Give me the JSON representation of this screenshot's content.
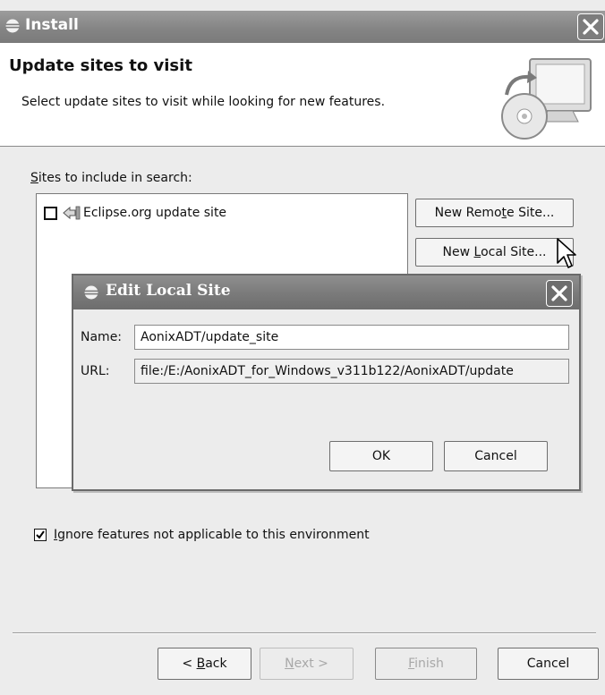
{
  "window": {
    "title": "Install"
  },
  "banner": {
    "title": "Update sites to visit",
    "description": "Select update sites to visit while looking for new features."
  },
  "sites": {
    "label_mnemonic": "S",
    "label_rest": "ites to include in search:",
    "items": [
      {
        "label": "Eclipse.org update site",
        "checked": false
      }
    ]
  },
  "buttons": {
    "new_remote_pre": "New Remo",
    "new_remote_mnemonic": "t",
    "new_remote_post": "e Site...",
    "new_local_pre": "New ",
    "new_local_mnemonic": "L",
    "new_local_post": "ocal Site..."
  },
  "dialog": {
    "title": "Edit Local Site",
    "name_label": "Name:",
    "name_value": "AonixADT/update_site",
    "url_label": "URL:",
    "url_value": "file:/E:/AonixADT_for_Windows_v311b122/AonixADT/update",
    "ok_label": "OK",
    "cancel_label": "Cancel"
  },
  "ignore_option": {
    "checked": true,
    "mnemonic": "I",
    "label_rest": "gnore features not applicable to this environment"
  },
  "footer": {
    "back_pre": "< ",
    "back_mnemonic": "B",
    "back_post": "ack",
    "next_mnemonic": "N",
    "next_post": "ext >",
    "finish_mnemonic": "F",
    "finish_post": "inish",
    "cancel_label": "Cancel"
  },
  "icons": {
    "window": "eclipse-icon",
    "close": "close-icon",
    "banner": "install-computer-cd-icon",
    "site": "update-site-icon",
    "cursor": "mouse-pointer-icon",
    "checkmark": "checkmark-icon"
  }
}
